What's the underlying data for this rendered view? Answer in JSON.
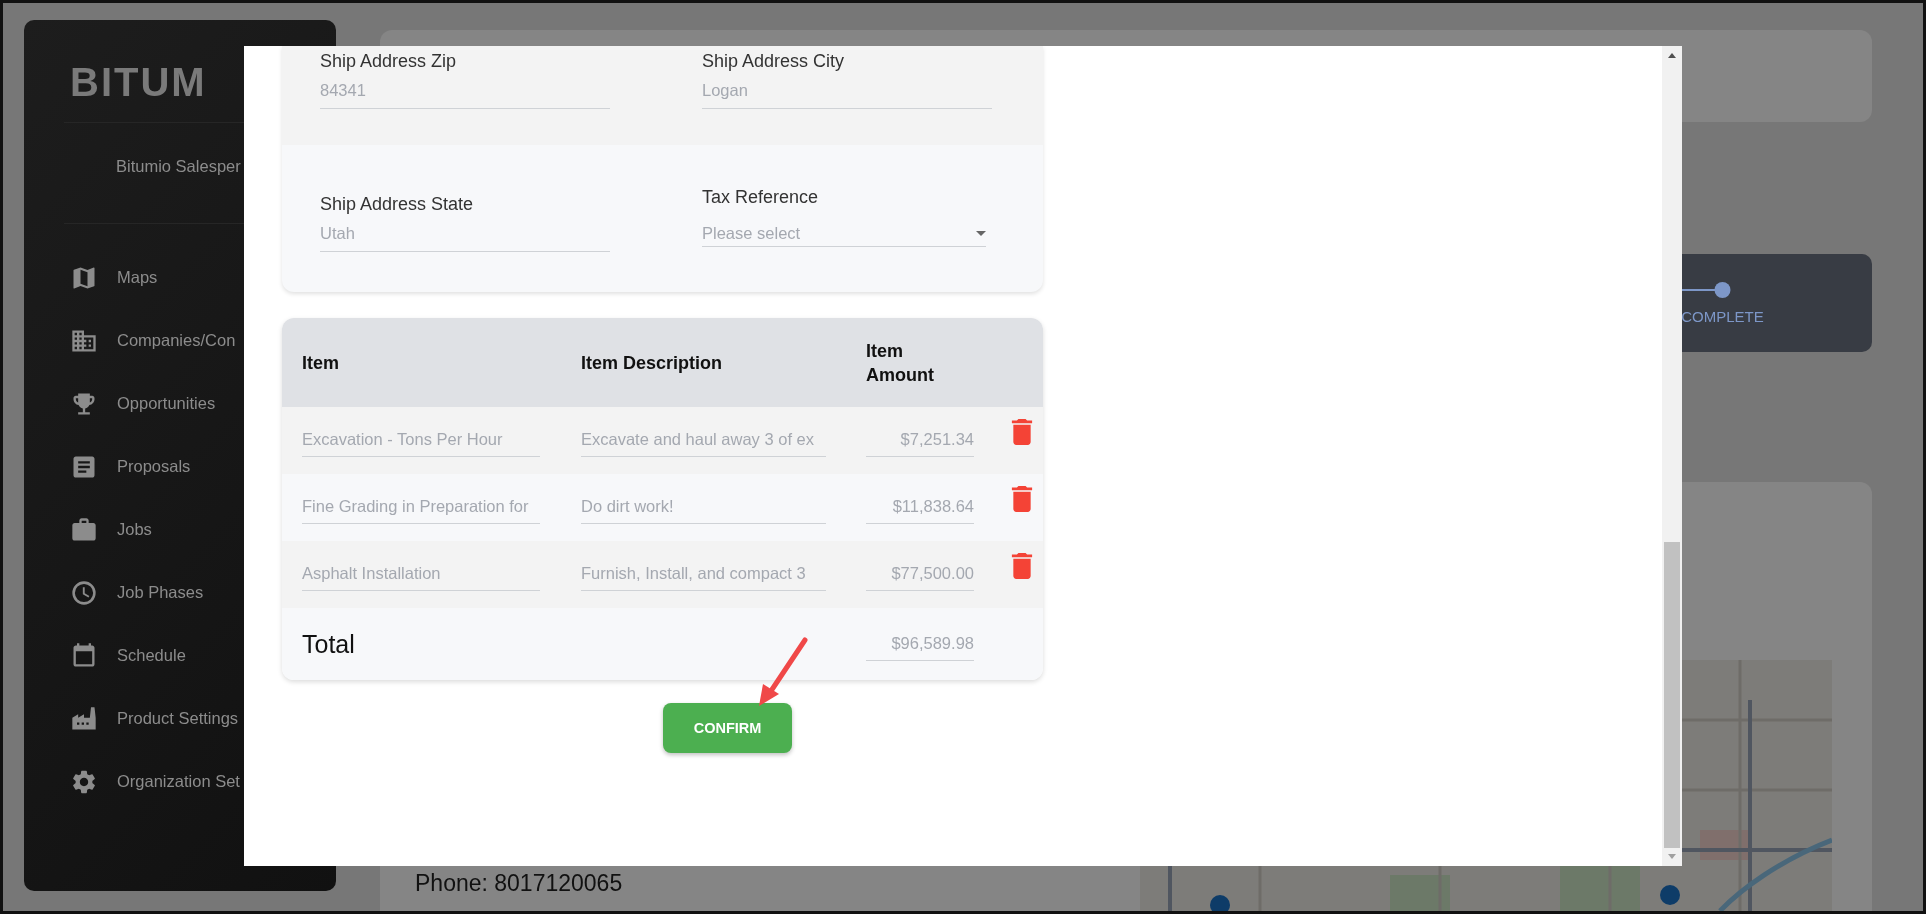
{
  "sidebar": {
    "logo": "BITUM",
    "user": "Bitumio Salesper",
    "items": [
      {
        "label": "Maps"
      },
      {
        "label": "Companies/Con"
      },
      {
        "label": "Opportunities"
      },
      {
        "label": "Proposals"
      },
      {
        "label": "Jobs"
      },
      {
        "label": "Job Phases"
      },
      {
        "label": "Schedule"
      },
      {
        "label": "Product Settings"
      },
      {
        "label": "Organization Set"
      }
    ]
  },
  "background": {
    "stepper_label": "COMPLETE",
    "phone": "Phone: 8017120065"
  },
  "modal": {
    "sections": [
      {
        "fields": [
          {
            "kind": "text",
            "label": "Ship Address Zip",
            "value": "84341"
          },
          {
            "kind": "text",
            "label": "Ship Address City",
            "value": "Logan"
          }
        ]
      },
      {
        "fields": [
          {
            "kind": "text",
            "label": "Ship Address State",
            "value": "Utah"
          },
          {
            "kind": "select",
            "label": "Tax Reference",
            "placeholder": "Please select"
          }
        ]
      }
    ],
    "table": {
      "columns": [
        "Item",
        "Item Description",
        "Item Amount"
      ],
      "rows": [
        {
          "item": "Excavation - Tons Per Hour",
          "description": "Excavate and haul away 3 of ex",
          "amount": "$7,251.34"
        },
        {
          "item": "Fine Grading in Preparation for",
          "description": "Do dirt work!",
          "amount": "$11,838.64"
        },
        {
          "item": "Asphalt Installation",
          "description": "Furnish, Install, and compact 3",
          "amount": "$77,500.00"
        }
      ],
      "total_label": "Total",
      "total": "$96,589.98"
    },
    "confirm": "CONFIRM"
  }
}
